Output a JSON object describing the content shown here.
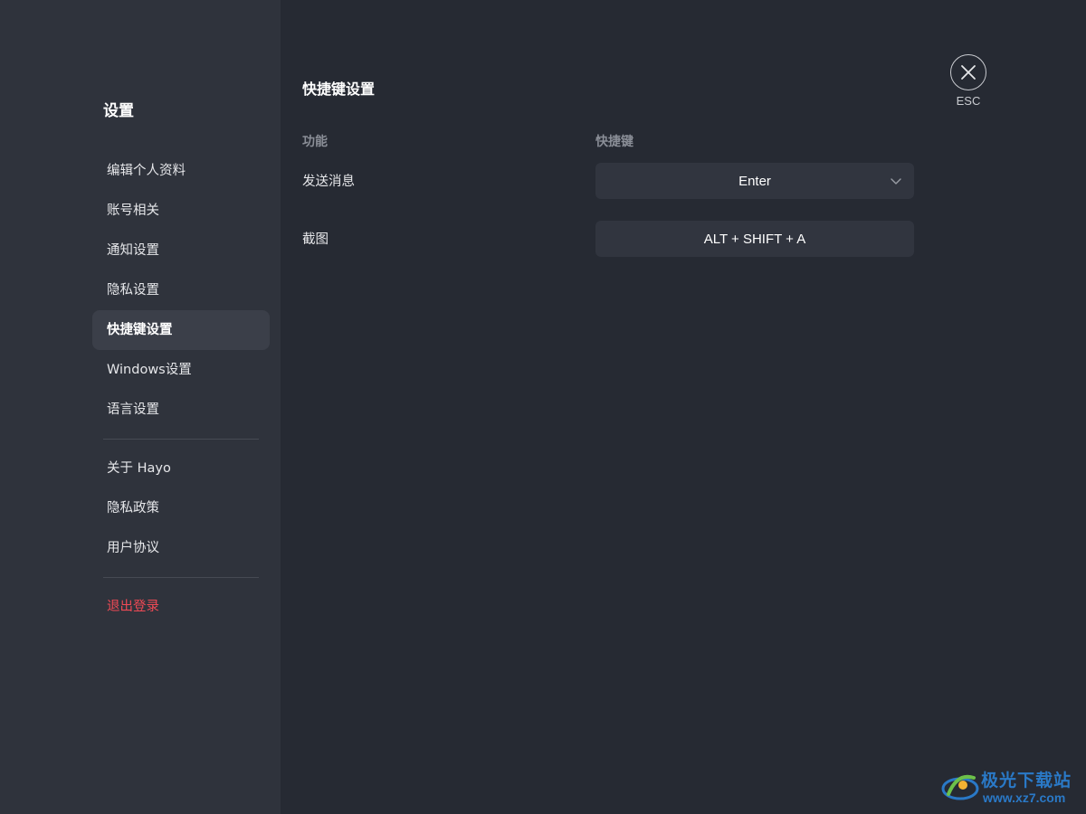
{
  "sidebar": {
    "title": "设置",
    "items": [
      {
        "label": "编辑个人资料"
      },
      {
        "label": "账号相关"
      },
      {
        "label": "通知设置"
      },
      {
        "label": "隐私设置"
      },
      {
        "label": "快捷键设置",
        "active": true
      },
      {
        "label": "Windows设置"
      },
      {
        "label": "语言设置"
      }
    ],
    "about_items": [
      {
        "label": "关于 Hayo"
      },
      {
        "label": "隐私政策"
      },
      {
        "label": "用户协议"
      }
    ],
    "logout_label": "退出登录"
  },
  "main": {
    "title": "快捷键设置",
    "columns": {
      "function": "功能",
      "shortcut": "快捷键"
    },
    "rows": [
      {
        "function": "发送消息",
        "shortcut": "Enter",
        "has_dropdown": true
      },
      {
        "function": "截图",
        "shortcut": "ALT + SHIFT + A",
        "has_dropdown": false
      }
    ]
  },
  "close": {
    "icon": "close-icon",
    "label": "ESC"
  },
  "watermark": {
    "title": "极光下载站",
    "url": "www.xz7.com"
  },
  "colors": {
    "background": "#262a33",
    "sidebar": "#2f333c",
    "active_item": "#3b3f49",
    "danger": "#ef4a55",
    "input": "#31353f"
  }
}
